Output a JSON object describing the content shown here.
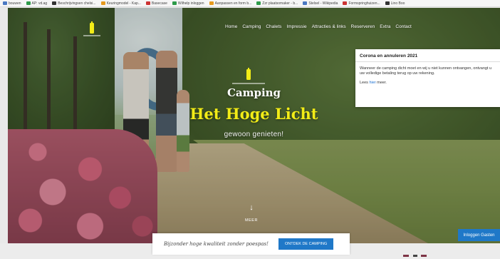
{
  "bookmarks": [
    {
      "label": "bouwen",
      "icon": "bookmark-icon"
    },
    {
      "label": "AP: vd.ag",
      "icon": "bookmark-icon"
    },
    {
      "label": "Beschrijvingsen chelsi...",
      "icon": "bookmark-icon"
    },
    {
      "label": "Keuringmodel - Kap...",
      "icon": "bookmark-icon"
    },
    {
      "label": "Basecase",
      "icon": "bookmark-icon"
    },
    {
      "label": "Wilhelp inloggen",
      "icon": "bookmark-icon"
    },
    {
      "label": "Aanpassen en form b...",
      "icon": "bookmark-icon"
    },
    {
      "label": "Zzr plaatsomaker - b...",
      "icon": "bookmark-icon"
    },
    {
      "label": "Stelsel - Wikipedia",
      "icon": "bookmark-icon"
    },
    {
      "label": "Formspringhuizen...",
      "icon": "bookmark-icon"
    },
    {
      "label": "Lino Boo",
      "icon": "bookmark-icon"
    }
  ],
  "nav": {
    "items": [
      "Home",
      "Camping",
      "Chalets",
      "Impressie",
      "Attracties & links",
      "Reserveren",
      "Extra",
      "Contact"
    ]
  },
  "hero": {
    "title_small": "Camping",
    "title_large": "Het Hoge Licht",
    "subtitle": "gewoon genieten!",
    "more_label": "MEER",
    "more_icon": "arrow-down-icon",
    "accent_color": "#f2ec17"
  },
  "popup": {
    "title": "Corona en annuleren 2021",
    "body": "Wanneer de camping dicht moet en wij u niet kunnen ontvangen, ontvangt u uw volledige betaling terug op uw rekening.",
    "link_prefix": "Lees ",
    "link_text": "hier",
    "link_suffix": " meer."
  },
  "cta": {
    "tagline": "Bijzonder hoge kwaliteit zonder poespas!",
    "button": "ONTDEK DE CAMPING",
    "button_color": "#1f78c8"
  },
  "login": {
    "label": "Inloggen Gasten"
  }
}
